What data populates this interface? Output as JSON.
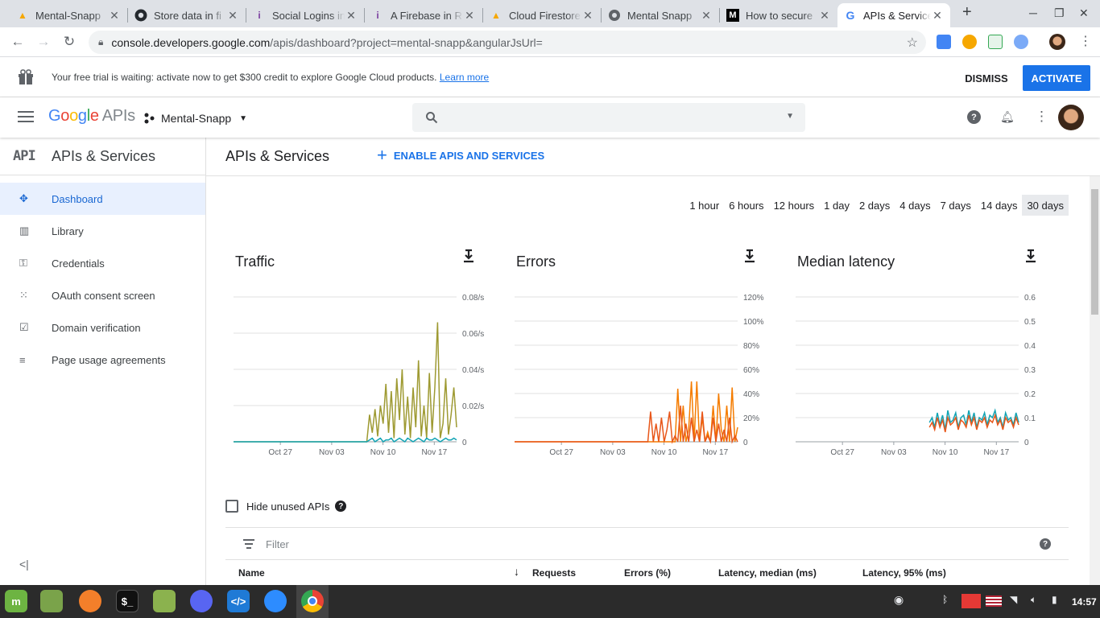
{
  "browser": {
    "tabs": [
      {
        "title": "Mental-Snapp",
        "icon": "firebase-icon"
      },
      {
        "title": "Store data in fi",
        "icon": "github-icon"
      },
      {
        "title": "Social Logins in",
        "icon": "info-icon"
      },
      {
        "title": "A Firebase in R",
        "icon": "info-icon"
      },
      {
        "title": "Cloud Firestore",
        "icon": "firebase-icon"
      },
      {
        "title": "Mental Snapp",
        "icon": "globe-icon"
      },
      {
        "title": "How to secure",
        "icon": "medium-icon"
      },
      {
        "title": "APIs & Service",
        "icon": "google-icon"
      }
    ],
    "url_host": "console.developers.google.com",
    "url_path": "/apis/dashboard?project=mental-snapp&angularJsUrl="
  },
  "banner": {
    "message": "Your free trial is waiting: activate now to get $300 credit to explore Google Cloud products.",
    "link": "Learn more",
    "dismiss": "DISMISS",
    "activate": "ACTIVATE"
  },
  "header": {
    "logo_google": "Google",
    "logo_apis": "APIs",
    "project": "Mental-Snapp"
  },
  "sidebar": {
    "icon_text": "API",
    "title": "APIs & Services",
    "items": [
      {
        "label": "Dashboard",
        "icon": "dashboard-icon",
        "active": true
      },
      {
        "label": "Library",
        "icon": "library-icon"
      },
      {
        "label": "Credentials",
        "icon": "key-icon"
      },
      {
        "label": "OAuth consent screen",
        "icon": "oauth-icon"
      },
      {
        "label": "Domain verification",
        "icon": "checkbox-icon"
      },
      {
        "label": "Page usage agreements",
        "icon": "settings-list-icon"
      }
    ]
  },
  "main": {
    "title": "APIs & Services",
    "enable_label": "ENABLE APIS AND SERVICES",
    "ranges": [
      "1 hour",
      "6 hours",
      "12 hours",
      "1 day",
      "2 days",
      "4 days",
      "7 days",
      "14 days",
      "30 days"
    ],
    "selected_range": "30 days",
    "hide_unused": "Hide unused APIs",
    "filter_placeholder": "Filter",
    "columns": [
      "Name",
      "Requests",
      "Errors (%)",
      "Latency, median (ms)",
      "Latency, 95% (ms)"
    ]
  },
  "colors": {
    "accent": "#1a73e8",
    "olive": "#9e9a32",
    "teal": "#12a4b4",
    "orange": "#f57c00",
    "red_orange": "#e8571a"
  },
  "chart_data": [
    {
      "type": "line",
      "title": "Traffic",
      "x_ticks": [
        "Oct 27",
        "Nov 03",
        "Nov 10",
        "Nov 17"
      ],
      "y_ticks": [
        "0",
        "0.02/s",
        "0.04/s",
        "0.06/s",
        "0.08/s"
      ],
      "ylim": [
        0,
        0.08
      ],
      "series": [
        {
          "color": "#9e9a32",
          "values": [
            0,
            0,
            0,
            0,
            0,
            0,
            0,
            0,
            0,
            0,
            0,
            0,
            0,
            0,
            0,
            0,
            0,
            0,
            0,
            0,
            0,
            0,
            0,
            0,
            0,
            0,
            0,
            0,
            0,
            0,
            0,
            0,
            0,
            0,
            0,
            0,
            0,
            0,
            0,
            0,
            0,
            0,
            0,
            0,
            0,
            0,
            0,
            0,
            0,
            0,
            0.015,
            0.005,
            0.018,
            0.003,
            0.02,
            0.01,
            0.032,
            0.005,
            0.028,
            0.002,
            0.035,
            0.012,
            0.04,
            0.004,
            0.025,
            0.002,
            0.03,
            0.008,
            0.045,
            0.003,
            0.02,
            0.002,
            0.038,
            0.005,
            0.03,
            0.066,
            0.002,
            0.01,
            0.035,
            0.004,
            0.015,
            0.03,
            0.008
          ]
        },
        {
          "color": "#12a4b4",
          "values": [
            0,
            0,
            0,
            0,
            0,
            0,
            0,
            0,
            0,
            0,
            0,
            0,
            0,
            0,
            0,
            0,
            0,
            0,
            0,
            0,
            0,
            0,
            0,
            0,
            0,
            0,
            0,
            0,
            0,
            0,
            0,
            0,
            0,
            0,
            0,
            0,
            0,
            0,
            0,
            0,
            0,
            0,
            0,
            0,
            0,
            0,
            0,
            0,
            0,
            0,
            0.001,
            0.002,
            0,
            0.001,
            0.002,
            0,
            0.001,
            0.001,
            0.002,
            0,
            0.001,
            0.002,
            0.001,
            0,
            0.002,
            0.001,
            0,
            0.001,
            0.002,
            0.001,
            0,
            0.002,
            0.001,
            0.001,
            0.002,
            0.001,
            0,
            0.001,
            0.002,
            0.001,
            0.001,
            0.002,
            0.001
          ]
        }
      ]
    },
    {
      "type": "line",
      "title": "Errors",
      "x_ticks": [
        "Oct 27",
        "Nov 03",
        "Nov 10",
        "Nov 17"
      ],
      "y_ticks": [
        "0",
        "20%",
        "40%",
        "60%",
        "80%",
        "100%",
        "120%"
      ],
      "ylim": [
        0,
        120
      ],
      "series": [
        {
          "color": "#f57c00",
          "values": [
            0,
            0,
            0,
            0,
            0,
            0,
            0,
            0,
            0,
            0,
            0,
            0,
            0,
            0,
            0,
            0,
            0,
            0,
            0,
            0,
            0,
            0,
            0,
            0,
            0,
            0,
            0,
            0,
            0,
            0,
            0,
            0,
            0,
            0,
            0,
            0,
            0,
            0,
            0,
            0,
            0,
            0,
            0,
            0,
            0,
            0,
            0,
            0,
            0,
            0,
            0,
            0,
            0,
            0,
            0,
            0,
            0,
            0,
            0,
            0,
            44,
            0,
            30,
            0,
            10,
            50,
            0,
            50,
            0,
            20,
            0,
            8,
            0,
            30,
            0,
            40,
            10,
            0,
            30,
            0,
            45,
            0,
            12
          ]
        },
        {
          "color": "#e8571a",
          "values": [
            0,
            0,
            0,
            0,
            0,
            0,
            0,
            0,
            0,
            0,
            0,
            0,
            0,
            0,
            0,
            0,
            0,
            0,
            0,
            0,
            0,
            0,
            0,
            0,
            0,
            0,
            0,
            0,
            0,
            0,
            0,
            0,
            0,
            0,
            0,
            0,
            0,
            0,
            0,
            0,
            0,
            0,
            0,
            0,
            0,
            0,
            0,
            0,
            0,
            0,
            25,
            0,
            15,
            0,
            20,
            0,
            10,
            25,
            0,
            5,
            0,
            30,
            0,
            15,
            0,
            20,
            0,
            10,
            0,
            25,
            0,
            5,
            0,
            20,
            0,
            15,
            0,
            10,
            0,
            20,
            0,
            5,
            0
          ]
        }
      ]
    },
    {
      "type": "line",
      "title": "Median latency",
      "x_ticks": [
        "Oct 27",
        "Nov 03",
        "Nov 10",
        "Nov 17"
      ],
      "y_ticks": [
        "0",
        "0.1",
        "0.2",
        "0.3",
        "0.4",
        "0.5",
        "0.6"
      ],
      "ylim": [
        0,
        0.6
      ],
      "series": [
        {
          "color": "#12a4b4",
          "values": [
            0.08,
            0.1,
            0.06,
            0.12,
            0.07,
            0.11,
            0.05,
            0.13,
            0.08,
            0.09,
            0.12,
            0.06,
            0.1,
            0.11,
            0.07,
            0.13,
            0.08,
            0.12,
            0.06,
            0.1,
            0.09,
            0.12,
            0.07,
            0.11,
            0.1,
            0.13,
            0.08,
            0.1,
            0.06,
            0.12,
            0.09,
            0.1,
            0.07,
            0.12,
            0.08
          ]
        },
        {
          "color": "#e8571a",
          "values": [
            0.06,
            0.08,
            0.05,
            0.1,
            0.06,
            0.09,
            0.04,
            0.1,
            0.07,
            0.08,
            0.1,
            0.05,
            0.09,
            0.08,
            0.06,
            0.11,
            0.07,
            0.1,
            0.05,
            0.09,
            0.08,
            0.1,
            0.06,
            0.09,
            0.08,
            0.11,
            0.07,
            0.09,
            0.05,
            0.1,
            0.08,
            0.09,
            0.06,
            0.1,
            0.07
          ]
        }
      ]
    }
  ],
  "taskbar": {
    "clock": "14:57"
  }
}
